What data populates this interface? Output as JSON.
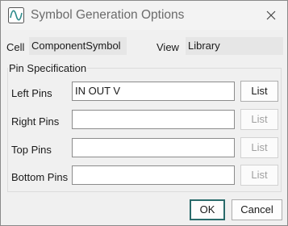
{
  "window": {
    "title": "Symbol Generation Options",
    "app_icon": "waveform-icon",
    "close_icon": "close-icon"
  },
  "cell": {
    "label": "Cell",
    "value": "ComponentSymbol"
  },
  "view": {
    "label": "View",
    "value": "Library"
  },
  "pin_spec": {
    "title": "Pin Specification",
    "rows": [
      {
        "label": "Left Pins",
        "value": "IN OUT V",
        "button": "List",
        "button_enabled": true
      },
      {
        "label": "Right Pins",
        "value": "",
        "button": "List",
        "button_enabled": false
      },
      {
        "label": "Top Pins",
        "value": "",
        "button": "List",
        "button_enabled": false
      },
      {
        "label": "Bottom Pins",
        "value": "",
        "button": "List",
        "button_enabled": false
      }
    ]
  },
  "buttons": {
    "ok": "OK",
    "cancel": "Cancel"
  },
  "colors": {
    "default_button_border": "#2a6b6b",
    "icon_accent": "#2e8b8b"
  }
}
